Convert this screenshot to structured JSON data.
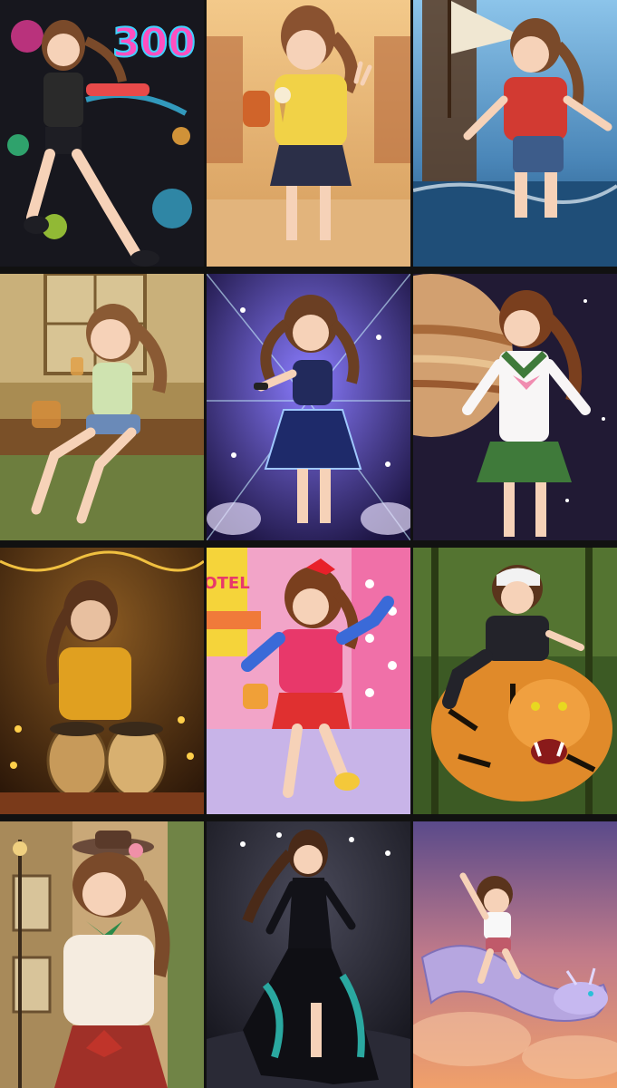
{
  "collage": {
    "columns": 3,
    "rows": 4,
    "tiles": [
      {
        "name": "paint-splash-300",
        "text": "300",
        "colors": {
          "bg": "#1b1b22",
          "accent": "#ff3fa4",
          "hair": "#7a4a2a"
        }
      },
      {
        "name": "ice-cream-market",
        "colors": {
          "bg": "#e8b070",
          "accent": "#f1d247",
          "hair": "#8a5230"
        }
      },
      {
        "name": "pirate-ship",
        "colors": {
          "bg": "#5fa0d0",
          "accent": "#d23a32",
          "hair": "#7a4a2a"
        }
      },
      {
        "name": "tea-veranda",
        "colors": {
          "bg": "#b8a060",
          "accent": "#cfe3b0",
          "hair": "#8a5a34"
        }
      },
      {
        "name": "concert-stage",
        "colors": {
          "bg": "#2c1f5e",
          "accent": "#6a5cff",
          "hair": "#6b3f23"
        }
      },
      {
        "name": "jupiter-sailor",
        "colors": {
          "bg": "#2a1e3a",
          "accent": "#3f7a3a",
          "hair": "#7a3f1e"
        }
      },
      {
        "name": "tabla-diwali",
        "colors": {
          "bg": "#4a2a14",
          "accent": "#e0a020",
          "hair": "#5a341c"
        }
      },
      {
        "name": "retro-street-otel",
        "text": "OTEL",
        "colors": {
          "bg": "#f08cbe",
          "accent": "#e8386a",
          "hair": "#7a3f1e"
        }
      },
      {
        "name": "tiger-ride",
        "colors": {
          "bg": "#4a6a2a",
          "accent": "#e08a2a",
          "hair": "#5a341c"
        }
      },
      {
        "name": "victorian-bonnet",
        "colors": {
          "bg": "#c9a878",
          "accent": "#c0342a",
          "hair": "#7a4a2a"
        }
      },
      {
        "name": "runway-gown",
        "colors": {
          "bg": "#1a1a22",
          "accent": "#2aa8a0",
          "hair": "#4a2a18"
        }
      },
      {
        "name": "dragon-sky",
        "colors": {
          "bg": "#6a4a8a",
          "accent": "#f0a06a",
          "hair": "#5a341c"
        }
      }
    ]
  }
}
